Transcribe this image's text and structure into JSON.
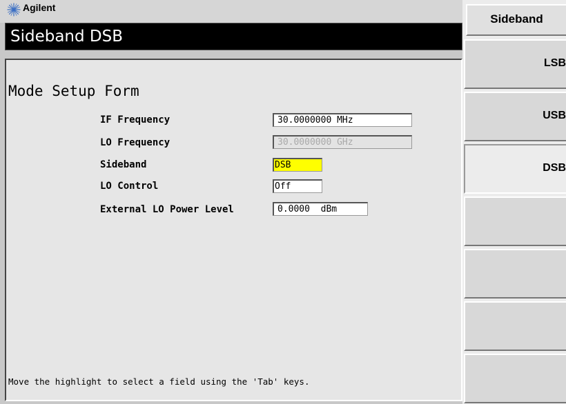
{
  "brand": {
    "name": "Agilent",
    "logo_icon": "agilent-spark-icon",
    "color": "#3b6fc4"
  },
  "title_bar": {
    "text": "Sideband DSB"
  },
  "form": {
    "title": "Mode Setup Form",
    "fields": [
      {
        "label": "IF Frequency",
        "value": "30.0000000 MHz",
        "state": "normal"
      },
      {
        "label": "LO Frequency",
        "value": "30.0000000 GHz",
        "state": "disabled"
      },
      {
        "label": "Sideband",
        "value": "DSB",
        "state": "highlighted",
        "highlight_color": "#ffff00"
      },
      {
        "label": "LO Control",
        "value": "Off",
        "state": "normal"
      },
      {
        "label": "External LO Power Level",
        "value": "0.0000  dBm",
        "state": "normal"
      }
    ],
    "help": "Move the highlight to select a field using the 'Tab' keys."
  },
  "softkeys": {
    "header": "Sideband",
    "keys": [
      {
        "label": "LSB",
        "active": false
      },
      {
        "label": "USB",
        "active": false
      },
      {
        "label": "DSB",
        "active": true
      },
      {
        "label": "",
        "active": false
      },
      {
        "label": "",
        "active": false
      },
      {
        "label": "",
        "active": false
      },
      {
        "label": "",
        "active": false
      }
    ]
  }
}
